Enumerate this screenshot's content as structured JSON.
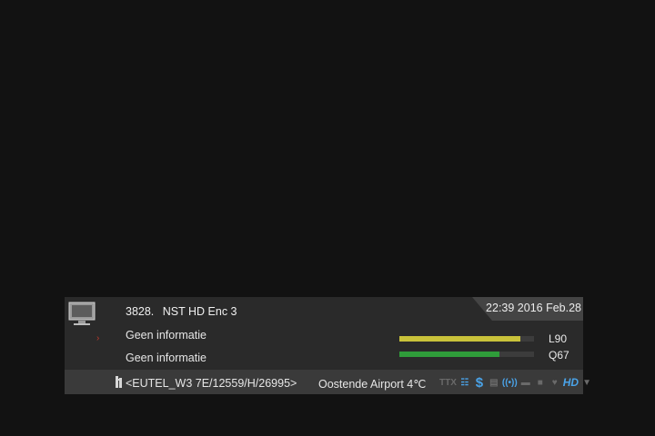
{
  "infobar": {
    "channel_number": "3828.",
    "channel_name": "NST HD Enc 3",
    "datetime": "22:39 2016 Feb.28",
    "epg_now": "Geen informatie",
    "epg_next": "Geen informatie",
    "signal_level": {
      "label": "L90",
      "fraction": 0.9
    },
    "signal_quality": {
      "label": "Q67",
      "fraction": 0.74
    }
  },
  "statusbar": {
    "transponder": "<EUTEL_W3 7E/12559/H/26995>",
    "weather": "Oostende Airport 4℃",
    "icons": [
      {
        "name": "ttx-icon",
        "text": "TTX",
        "active": false
      },
      {
        "name": "subtitle-icon",
        "text": "☷",
        "active": true
      },
      {
        "name": "scrambled-icon",
        "text": "$",
        "active": true
      },
      {
        "name": "epg-icon",
        "text": "▤",
        "active": false
      },
      {
        "name": "signal-wave-icon",
        "text": "((•))",
        "active": true
      },
      {
        "name": "hdd-icon",
        "text": "▬",
        "active": false
      },
      {
        "name": "lock-icon",
        "text": "■",
        "active": false
      },
      {
        "name": "favorite-icon",
        "text": "♥",
        "active": false
      },
      {
        "name": "hd-icon",
        "text": "HD",
        "active": true
      },
      {
        "name": "wifi-icon",
        "text": "▼",
        "active": false
      }
    ]
  },
  "colors": {
    "level_bar": "#c9c23a",
    "quality_bar": "#2f9c3a",
    "active_icon": "#4aa3e8",
    "epg_arrow": "#c0392b"
  }
}
